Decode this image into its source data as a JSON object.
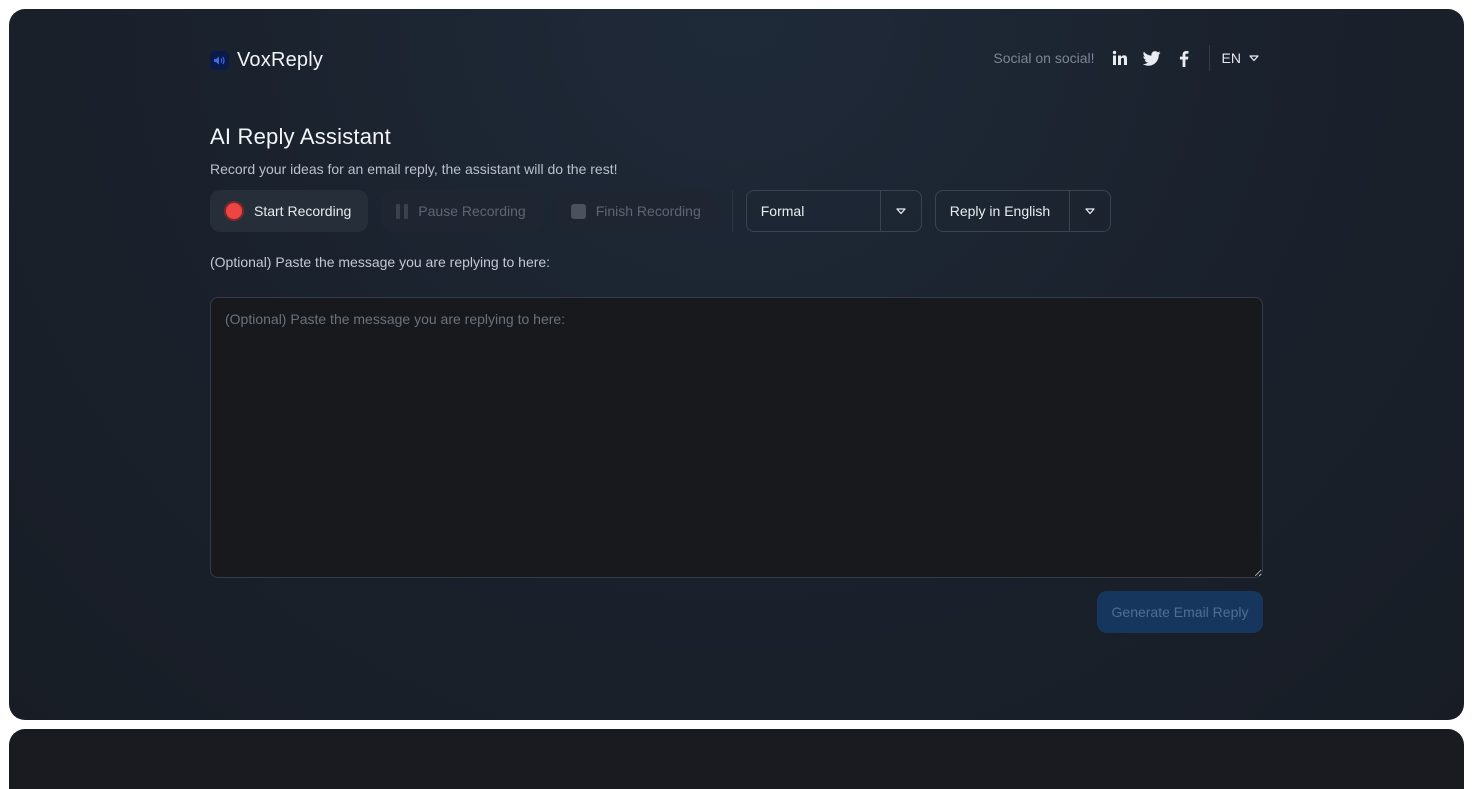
{
  "brand": {
    "name": "VoxReply",
    "icon": "speaker-icon",
    "color": "#0b1a4a"
  },
  "header": {
    "social_label": "Social on social!",
    "social_icons": [
      "linkedin-icon",
      "twitter-icon",
      "facebook-icon"
    ],
    "language": "EN"
  },
  "main": {
    "title": "AI Reply Assistant",
    "subtitle": "Record your ideas for an email reply, the assistant will do the rest!",
    "recording": {
      "start_label": "Start Recording",
      "pause_label": "Pause Recording",
      "finish_label": "Finish Recording",
      "record_dot_color": "#ef4444"
    },
    "tone_select": {
      "value": "Formal"
    },
    "language_select": {
      "value": "Reply in English"
    },
    "message_label": "(Optional) Paste the message you are replying to here:",
    "message_textarea": {
      "value": "",
      "placeholder": "(Optional) Paste the message you are replying to here:"
    },
    "generate_label": "Generate Email Reply"
  }
}
